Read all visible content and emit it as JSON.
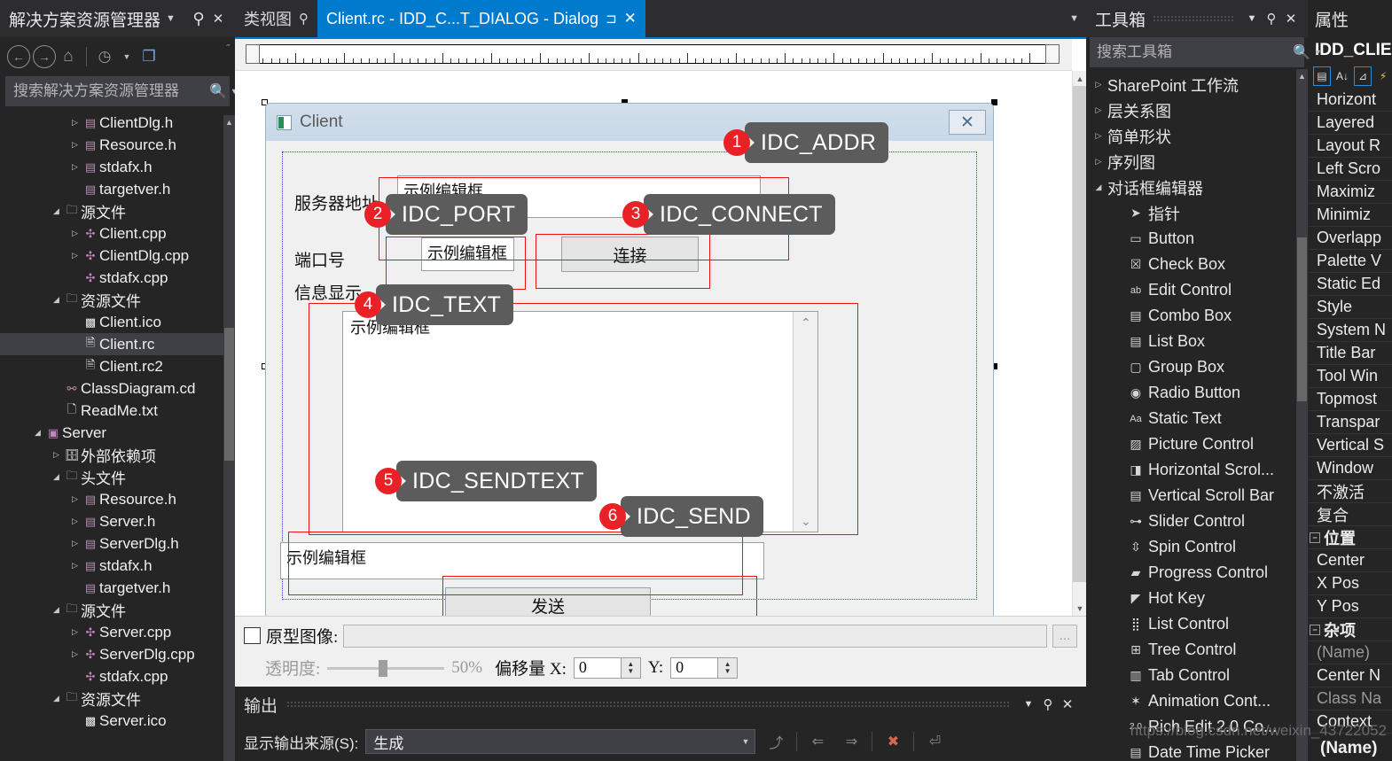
{
  "solution_explorer": {
    "title": "解决方案资源管理器",
    "search_placeholder": "搜索解决方案资源管理器",
    "icons": {
      "caret": "chevron-down-icon",
      "pin": "pin-icon",
      "close": "close-icon",
      "back": "back-icon",
      "forward": "forward-icon",
      "home": "home-icon",
      "pending": "pending-changes-icon",
      "views": "views-icon",
      "search": "search-icon"
    },
    "tree": [
      {
        "label": "ClientDlg.h",
        "indent": 3,
        "arrow": "closed",
        "icon": "header-file-icon",
        "selected": false
      },
      {
        "label": "Resource.h",
        "indent": 3,
        "arrow": "closed",
        "icon": "header-file-icon",
        "selected": false
      },
      {
        "label": "stdafx.h",
        "indent": 3,
        "arrow": "closed",
        "icon": "header-file-icon",
        "selected": false
      },
      {
        "label": "targetver.h",
        "indent": 3,
        "arrow": "none",
        "icon": "header-file-icon",
        "selected": false
      },
      {
        "label": "源文件",
        "indent": 2,
        "arrow": "open",
        "icon": "folder-icon",
        "selected": false
      },
      {
        "label": "Client.cpp",
        "indent": 3,
        "arrow": "closed",
        "icon": "cpp-file-icon",
        "selected": false
      },
      {
        "label": "ClientDlg.cpp",
        "indent": 3,
        "arrow": "closed",
        "icon": "cpp-file-icon",
        "selected": false
      },
      {
        "label": "stdafx.cpp",
        "indent": 3,
        "arrow": "none",
        "icon": "cpp-file-icon",
        "selected": false
      },
      {
        "label": "资源文件",
        "indent": 2,
        "arrow": "open",
        "icon": "folder-icon",
        "selected": false
      },
      {
        "label": "Client.ico",
        "indent": 3,
        "arrow": "none",
        "icon": "image-file-icon",
        "selected": false
      },
      {
        "label": "Client.rc",
        "indent": 3,
        "arrow": "none",
        "icon": "rc-file-icon",
        "selected": true
      },
      {
        "label": "Client.rc2",
        "indent": 3,
        "arrow": "none",
        "icon": "rc-file-icon",
        "selected": false
      },
      {
        "label": "ClassDiagram.cd",
        "indent": 2,
        "arrow": "none",
        "icon": "class-diagram-icon",
        "selected": false
      },
      {
        "label": "ReadMe.txt",
        "indent": 2,
        "arrow": "none",
        "icon": "text-file-icon",
        "selected": false
      },
      {
        "label": "Server",
        "indent": 1,
        "arrow": "open",
        "icon": "project-icon",
        "selected": false
      },
      {
        "label": "外部依赖项",
        "indent": 2,
        "arrow": "closed",
        "icon": "dependencies-icon",
        "selected": false
      },
      {
        "label": "头文件",
        "indent": 2,
        "arrow": "open",
        "icon": "folder-icon",
        "selected": false
      },
      {
        "label": "Resource.h",
        "indent": 3,
        "arrow": "closed",
        "icon": "header-file-icon",
        "selected": false
      },
      {
        "label": "Server.h",
        "indent": 3,
        "arrow": "closed",
        "icon": "header-file-icon",
        "selected": false
      },
      {
        "label": "ServerDlg.h",
        "indent": 3,
        "arrow": "closed",
        "icon": "header-file-icon",
        "selected": false
      },
      {
        "label": "stdafx.h",
        "indent": 3,
        "arrow": "closed",
        "icon": "header-file-icon",
        "selected": false
      },
      {
        "label": "targetver.h",
        "indent": 3,
        "arrow": "none",
        "icon": "header-file-icon",
        "selected": false
      },
      {
        "label": "源文件",
        "indent": 2,
        "arrow": "open",
        "icon": "folder-icon",
        "selected": false
      },
      {
        "label": "Server.cpp",
        "indent": 3,
        "arrow": "closed",
        "icon": "cpp-file-icon",
        "selected": false
      },
      {
        "label": "ServerDlg.cpp",
        "indent": 3,
        "arrow": "closed",
        "icon": "cpp-file-icon",
        "selected": false
      },
      {
        "label": "stdafx.cpp",
        "indent": 3,
        "arrow": "none",
        "icon": "cpp-file-icon",
        "selected": false
      },
      {
        "label": "资源文件",
        "indent": 2,
        "arrow": "open",
        "icon": "folder-icon",
        "selected": false
      },
      {
        "label": "Server.ico",
        "indent": 3,
        "arrow": "none",
        "icon": "image-file-icon",
        "selected": false
      }
    ]
  },
  "tabs": {
    "class_view": {
      "label": "类视图",
      "pin": "pin-icon"
    },
    "active": {
      "label": "Client.rc - IDD_C...T_DIALOG - Dialog",
      "pin": "pin-icon",
      "close": "close-icon"
    },
    "overflow": "chevron-down-icon"
  },
  "dialog": {
    "title": "Client",
    "close_label": "✕",
    "labels": {
      "server_addr": "服务器地址",
      "port": "端口号",
      "info": "信息显示"
    },
    "fields": {
      "addr_text": "示例编辑框",
      "port_text": "示例编辑框",
      "log_text": "示例编辑框",
      "send_text": "示例编辑框"
    },
    "buttons": {
      "connect": "连接",
      "send": "发送"
    }
  },
  "callouts": [
    {
      "num": "1",
      "id": "IDC_ADDR"
    },
    {
      "num": "2",
      "id": "IDC_PORT"
    },
    {
      "num": "3",
      "id": "IDC_CONNECT"
    },
    {
      "num": "4",
      "id": "IDC_TEXT"
    },
    {
      "num": "5",
      "id": "IDC_SENDTEXT"
    },
    {
      "num": "6",
      "id": "IDC_SEND"
    }
  ],
  "prototype_panel": {
    "checkbox_label": "原型图像:",
    "path_value": "",
    "browse_label": "...",
    "transparency_label": "透明度:",
    "transparency_value": "50%",
    "offset_label": "偏移量 X:",
    "offset_x": "0",
    "offset_y_label": "Y:",
    "offset_y": "0"
  },
  "output_panel": {
    "title": "输出",
    "source_label": "显示输出来源(S):",
    "source_value": "生成",
    "icons": [
      "goto-message-icon",
      "prev-message-icon",
      "next-message-icon",
      "clear-all-icon",
      "word-wrap-icon"
    ],
    "caret": "chevron-down-icon",
    "pin": "pin-icon",
    "close": "close-icon"
  },
  "toolbox": {
    "title": "工具箱",
    "search_placeholder": "搜索工具箱",
    "items": [
      {
        "label": "SharePoint 工作流",
        "arrow": "closed",
        "icon": "",
        "child": false
      },
      {
        "label": "层关系图",
        "arrow": "closed",
        "icon": "",
        "child": false
      },
      {
        "label": "简单形状",
        "arrow": "closed",
        "icon": "",
        "child": false
      },
      {
        "label": "序列图",
        "arrow": "closed",
        "icon": "",
        "child": false
      },
      {
        "label": "对话框编辑器",
        "arrow": "open",
        "icon": "",
        "child": false
      },
      {
        "label": "指针",
        "arrow": "none",
        "icon": "pointer-icon",
        "child": true
      },
      {
        "label": "Button",
        "arrow": "none",
        "icon": "button-icon",
        "child": true
      },
      {
        "label": "Check Box",
        "arrow": "none",
        "icon": "checkbox-icon",
        "child": true
      },
      {
        "label": "Edit Control",
        "arrow": "none",
        "icon": "edit-control-icon",
        "child": true
      },
      {
        "label": "Combo Box",
        "arrow": "none",
        "icon": "combobox-icon",
        "child": true
      },
      {
        "label": "List Box",
        "arrow": "none",
        "icon": "listbox-icon",
        "child": true
      },
      {
        "label": "Group Box",
        "arrow": "none",
        "icon": "groupbox-icon",
        "child": true
      },
      {
        "label": "Radio Button",
        "arrow": "none",
        "icon": "radio-button-icon",
        "child": true
      },
      {
        "label": "Static Text",
        "arrow": "none",
        "icon": "static-text-icon",
        "child": true
      },
      {
        "label": "Picture Control",
        "arrow": "none",
        "icon": "picture-control-icon",
        "child": true
      },
      {
        "label": "Horizontal Scrol...",
        "arrow": "none",
        "icon": "hscrollbar-icon",
        "child": true
      },
      {
        "label": "Vertical Scroll Bar",
        "arrow": "none",
        "icon": "vscrollbar-icon",
        "child": true
      },
      {
        "label": "Slider Control",
        "arrow": "none",
        "icon": "slider-icon",
        "child": true
      },
      {
        "label": "Spin Control",
        "arrow": "none",
        "icon": "spin-icon",
        "child": true
      },
      {
        "label": "Progress Control",
        "arrow": "none",
        "icon": "progress-icon",
        "child": true
      },
      {
        "label": "Hot Key",
        "arrow": "none",
        "icon": "hotkey-icon",
        "child": true
      },
      {
        "label": "List Control",
        "arrow": "none",
        "icon": "list-control-icon",
        "child": true
      },
      {
        "label": "Tree Control",
        "arrow": "none",
        "icon": "tree-control-icon",
        "child": true
      },
      {
        "label": "Tab Control",
        "arrow": "none",
        "icon": "tab-control-icon",
        "child": true
      },
      {
        "label": "Animation Cont...",
        "arrow": "none",
        "icon": "animation-icon",
        "child": true
      },
      {
        "label": "Rich Edit 2.0 Co...",
        "arrow": "none",
        "icon": "rich-edit-icon",
        "child": true
      },
      {
        "label": "Date Time Picker",
        "arrow": "none",
        "icon": "datetime-picker-icon",
        "child": true
      }
    ]
  },
  "properties": {
    "title": "属性",
    "object": "IDD_CLIEN",
    "rows": [
      {
        "label": "Horizont",
        "type": "item"
      },
      {
        "label": "Layered",
        "type": "item"
      },
      {
        "label": "Layout R",
        "type": "item"
      },
      {
        "label": "Left Scro",
        "type": "item"
      },
      {
        "label": "Maximiz",
        "type": "item"
      },
      {
        "label": "Minimiz",
        "type": "item"
      },
      {
        "label": "Overlapp",
        "type": "item"
      },
      {
        "label": "Palette V",
        "type": "item"
      },
      {
        "label": "Static Ed",
        "type": "item"
      },
      {
        "label": "Style",
        "type": "item"
      },
      {
        "label": "System N",
        "type": "item"
      },
      {
        "label": "Title Bar",
        "type": "item"
      },
      {
        "label": "Tool Win",
        "type": "item"
      },
      {
        "label": "Topmost",
        "type": "item"
      },
      {
        "label": "Transpar",
        "type": "item"
      },
      {
        "label": "Vertical S",
        "type": "item"
      },
      {
        "label": "Window",
        "type": "item"
      },
      {
        "label": "不激活",
        "type": "item"
      },
      {
        "label": "复合",
        "type": "item"
      },
      {
        "label": "位置",
        "type": "group"
      },
      {
        "label": "Center",
        "type": "item"
      },
      {
        "label": "X Pos",
        "type": "item"
      },
      {
        "label": "Y Pos",
        "type": "item"
      },
      {
        "label": "杂项",
        "type": "group"
      },
      {
        "label": "(Name)",
        "type": "muted"
      },
      {
        "label": "Center N",
        "type": "item"
      },
      {
        "label": "Class Na",
        "type": "muted"
      },
      {
        "label": "Context",
        "type": "item"
      }
    ],
    "footer": "(Name)"
  },
  "watermark": "https://blog.csdn.net/weixin_43722052"
}
